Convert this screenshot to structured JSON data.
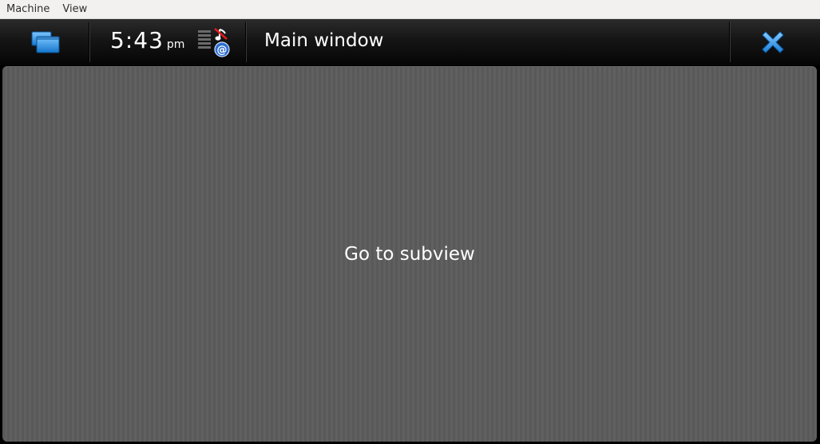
{
  "menubar": {
    "items": [
      {
        "label": "Machine"
      },
      {
        "label": "View"
      }
    ]
  },
  "statusbar": {
    "switcher_icon": "task-switcher-icon",
    "clock": {
      "time": "5:43",
      "ampm": "pm"
    },
    "status_icons": [
      "signal-strength-icon",
      "silent-profile-icon",
      "email-icon"
    ],
    "title": "Main window",
    "close_icon": "close-icon"
  },
  "main": {
    "button_label": "Go to subview"
  },
  "colors": {
    "accent_blue": "#1f8fe6",
    "content_bg": "#5e5d5e",
    "statusbar_bg": "#111111"
  }
}
